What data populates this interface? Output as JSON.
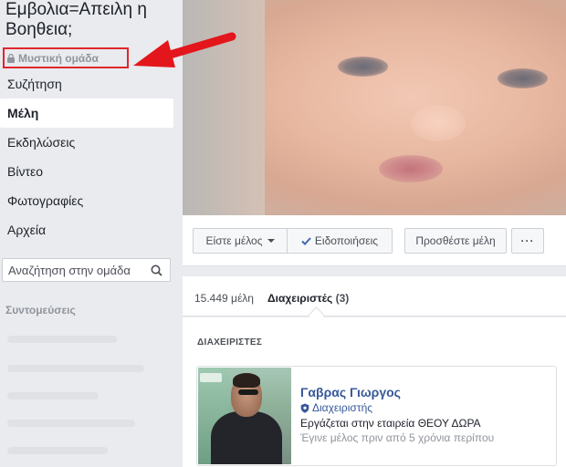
{
  "group": {
    "title": "Εμβολια=Απειλη η Βοηθεια;",
    "privacy": "Μυστική ομάδα"
  },
  "sidebar": {
    "items": [
      {
        "label": "Συζήτηση",
        "active": false
      },
      {
        "label": "Μέλη",
        "active": true
      },
      {
        "label": "Εκδηλώσεις",
        "active": false
      },
      {
        "label": "Βίντεο",
        "active": false
      },
      {
        "label": "Φωτογραφίες",
        "active": false
      },
      {
        "label": "Αρχεία",
        "active": false
      }
    ],
    "search_placeholder": "Αναζήτηση στην ομάδα",
    "shortcuts_label": "Συντομεύσεις"
  },
  "actions": {
    "member_label": "Είστε μέλος",
    "notifications_label": "Ειδοποιήσεις",
    "add_members_label": "Προσθέστε μέλη",
    "more_label": "···"
  },
  "members": {
    "count_label": "15.449 μέλη",
    "admins_tab_label": "Διαχειριστές",
    "admins_tab_count": "(3)",
    "section_label": "ΔΙΑΧΕΙΡΙΣΤΕΣ",
    "admin": {
      "name": "Γαβρας Γιωργος",
      "role": "Διαχειριστής",
      "work": "Εργάζεται στην εταιρεία ΘΕΟΥ ΔΩΡΑ",
      "joined": "Έγινε μέλος πριν από 5 χρόνια περίπου"
    }
  },
  "colors": {
    "accent": "#365899",
    "highlight_border": "#e0262c",
    "arrow": "#e3161c"
  }
}
